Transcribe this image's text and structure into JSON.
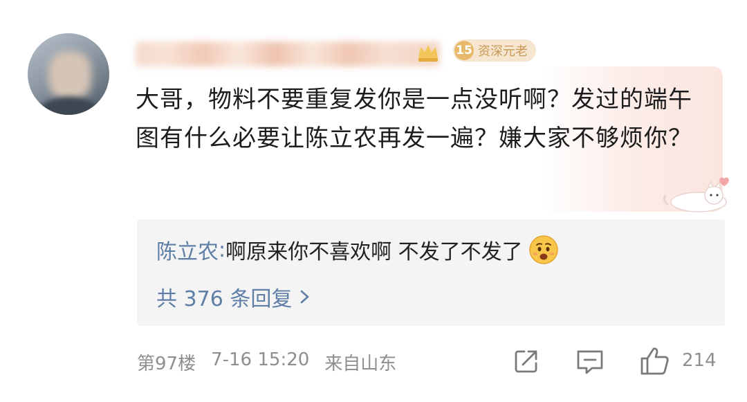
{
  "comment": {
    "level": "15",
    "level_title": "资深元老",
    "text": "大哥，物料不要重复发你是一点没听啊？发过的端午图有什么必要让陈立农再发一遍？嫌大家不够烦你？"
  },
  "reply": {
    "author": "陈立农",
    "separator": ": ",
    "text": "啊原来你不喜欢啊 不发了不发了",
    "emoji_icon": "worried-face-emoji",
    "count_label": "共 376 条回复"
  },
  "footer": {
    "floor": "第97楼",
    "time": "7-16 15:20",
    "location": "来自山东",
    "like_count": "214"
  },
  "colors": {
    "link_blue": "#5e7ea6",
    "meta_gray": "#8e8e8e",
    "badge_gold": "#e8b96a",
    "reply_bg": "#f4f4f4"
  }
}
